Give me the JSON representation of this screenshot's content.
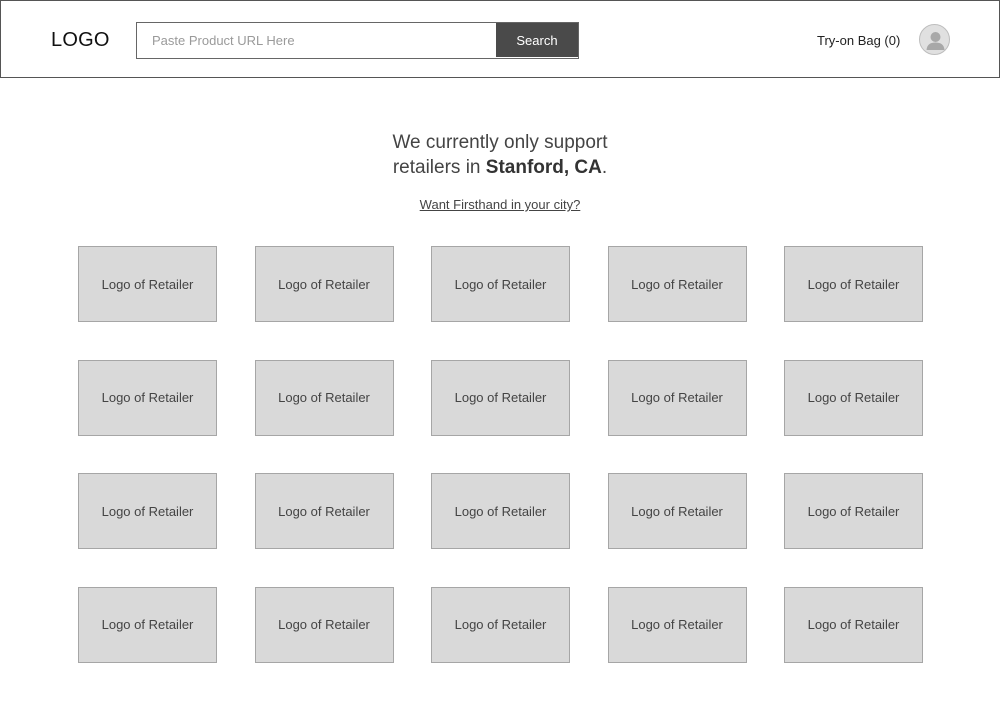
{
  "header": {
    "logo": "LOGO",
    "search": {
      "placeholder": "Paste Product URL Here",
      "value": "",
      "button_label": "Search"
    },
    "bag_label": "Try-on Bag (0)",
    "avatar_icon": "user-icon"
  },
  "main": {
    "headline_line1": "We currently only support",
    "headline_prefix": "retailers in ",
    "headline_city": "Stanford, CA",
    "headline_suffix": ".",
    "city_link": "Want Firsthand in your city?"
  },
  "retailers": [
    {
      "label": "Logo of Retailer"
    },
    {
      "label": "Logo of Retailer"
    },
    {
      "label": "Logo of Retailer"
    },
    {
      "label": "Logo of Retailer"
    },
    {
      "label": "Logo of Retailer"
    },
    {
      "label": "Logo of Retailer"
    },
    {
      "label": "Logo of Retailer"
    },
    {
      "label": "Logo of Retailer"
    },
    {
      "label": "Logo of Retailer"
    },
    {
      "label": "Logo of Retailer"
    },
    {
      "label": "Logo of Retailer"
    },
    {
      "label": "Logo of Retailer"
    },
    {
      "label": "Logo of Retailer"
    },
    {
      "label": "Logo of Retailer"
    },
    {
      "label": "Logo of Retailer"
    },
    {
      "label": "Logo of Retailer"
    },
    {
      "label": "Logo of Retailer"
    },
    {
      "label": "Logo of Retailer"
    },
    {
      "label": "Logo of Retailer"
    },
    {
      "label": "Logo of Retailer"
    }
  ]
}
